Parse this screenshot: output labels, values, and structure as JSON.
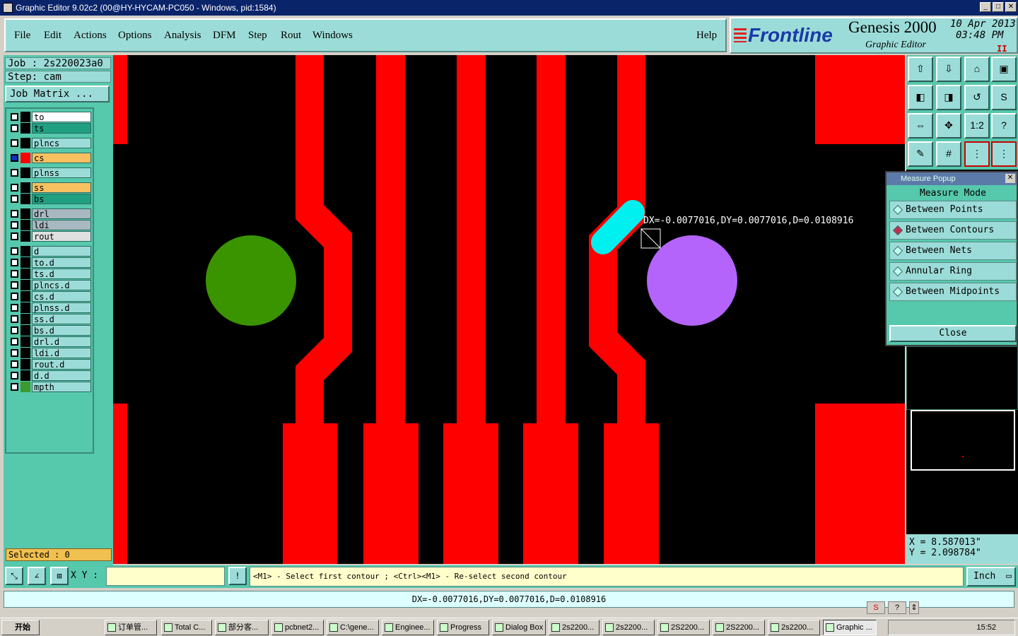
{
  "window": {
    "title": "Graphic Editor 9.02c2 (00@HY-HYCAM-PC050 - Windows, pid:1584)"
  },
  "menu": {
    "items": [
      "File",
      "Edit",
      "Actions",
      "Options",
      "Analysis",
      "DFM",
      "Step",
      "Rout",
      "Windows"
    ],
    "help": "Help"
  },
  "brand": {
    "logo": "Frontline",
    "product": "Genesis 2000",
    "subtitle": "Graphic Editor",
    "date": "10 Apr 2013",
    "time": "03:48 PM",
    "pause": "II"
  },
  "job": {
    "job_line": "Job : 2s220023a0",
    "step_line": "Step: cam",
    "matrix_button": "Job Matrix ..."
  },
  "layers": [
    {
      "name": "to",
      "color": "#ffffff",
      "swatch": "#000000"
    },
    {
      "name": "ts",
      "color": "#20a080",
      "swatch": "#000000"
    },
    {
      "name": "plncs",
      "color": "#9cdcd8",
      "swatch": "#000000"
    },
    {
      "name": "cs",
      "color": "#f8c060",
      "swatch": "#ff0000",
      "checked": true
    },
    {
      "name": "plnss",
      "color": "#9cdcd8",
      "swatch": "#000000"
    },
    {
      "name": "ss",
      "color": "#f8c060",
      "swatch": "#000000"
    },
    {
      "name": "bs",
      "color": "#20a080",
      "swatch": "#000000"
    },
    {
      "name": "drl",
      "color": "#a8b8c0",
      "swatch": "#000000"
    },
    {
      "name": "ldi",
      "color": "#a8b8c0",
      "swatch": "#000000"
    },
    {
      "name": "rout",
      "color": "#e0e0e0",
      "swatch": "#000000"
    },
    {
      "name": "d",
      "color": "#9cdcd8",
      "swatch": "#000000"
    },
    {
      "name": "to.d",
      "color": "#9cdcd8",
      "swatch": "#000000"
    },
    {
      "name": "ts.d",
      "color": "#9cdcd8",
      "swatch": "#000000"
    },
    {
      "name": "plncs.d",
      "color": "#9cdcd8",
      "swatch": "#000000"
    },
    {
      "name": "cs.d",
      "color": "#9cdcd8",
      "swatch": "#000000"
    },
    {
      "name": "plnss.d",
      "color": "#9cdcd8",
      "swatch": "#000000"
    },
    {
      "name": "ss.d",
      "color": "#9cdcd8",
      "swatch": "#000000"
    },
    {
      "name": "bs.d",
      "color": "#9cdcd8",
      "swatch": "#000000"
    },
    {
      "name": "drl.d",
      "color": "#9cdcd8",
      "swatch": "#000000"
    },
    {
      "name": "ldi.d",
      "color": "#9cdcd8",
      "swatch": "#000000"
    },
    {
      "name": "rout.d",
      "color": "#9cdcd8",
      "swatch": "#000000"
    },
    {
      "name": "d.d",
      "color": "#9cdcd8",
      "swatch": "#000000"
    },
    {
      "name": "mpth",
      "color": "#9cdcd8",
      "swatch": "#3a9a30"
    }
  ],
  "selected": "Selected : 0",
  "measure_popup": {
    "title": "Measure Popup",
    "mode_label": "Measure Mode",
    "options": [
      "Between Points",
      "Between Contours",
      "Between Nets",
      "Annular Ring",
      "Between Midpoints"
    ],
    "selected_option": "Between Contours",
    "close": "Close"
  },
  "measurement": "DX=-0.0077016,DY=0.0077016,D=0.0108916",
  "coords": {
    "x": "X = 8.587013\"",
    "y": "Y = 2.098784\""
  },
  "command": {
    "xy_label": "X Y :",
    "xy_value": "",
    "prompt": "<M1> - Select first contour ; <Ctrl><M1> - Re-select second contour",
    "unit": "Inch"
  },
  "status": "DX=-0.0077016,DY=0.0077016,D=0.0108916",
  "taskbar": {
    "start": "开始",
    "tasks": [
      "订单管...",
      "Total C...",
      "部分客...",
      "pcbnet2...",
      "C:\\gene...",
      "Enginee...",
      "Progress",
      "Dialog Box",
      "2s2200...",
      "2s2200...",
      "2S2200...",
      "2S2200...",
      "2s2200...",
      "Graphic ..."
    ],
    "clock": "15:52"
  },
  "colors": {
    "copper": "#ff0000",
    "pad_green": "#3a9400",
    "pad_purple": "#b464fa",
    "highlight": "#00f0f0",
    "panel": "#56c8ac"
  }
}
